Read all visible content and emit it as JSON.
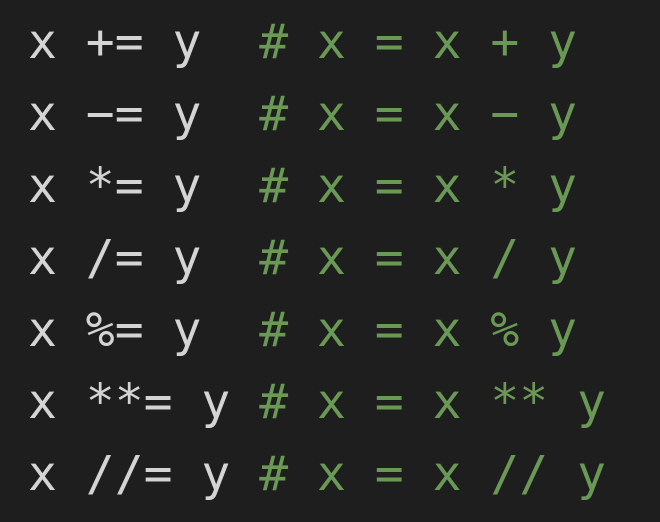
{
  "editor": {
    "lines": [
      {
        "code": "x += y  ",
        "comment": "# x = x + y"
      },
      {
        "code": "x −= y  ",
        "comment": "# x = x − y"
      },
      {
        "code": "x *= y  ",
        "comment": "# x = x * y"
      },
      {
        "code": "x /= y  ",
        "comment": "# x = x / y"
      },
      {
        "code": "x %= y  ",
        "comment": "# x = x % y"
      },
      {
        "code": "x **= y ",
        "comment": "# x = x ** y"
      },
      {
        "code": "x //= y ",
        "comment": "# x = x // y"
      }
    ]
  },
  "colors": {
    "background": "#1e1e1e",
    "code_text": "#d4d4d4",
    "comment_text": "#6a9955"
  }
}
